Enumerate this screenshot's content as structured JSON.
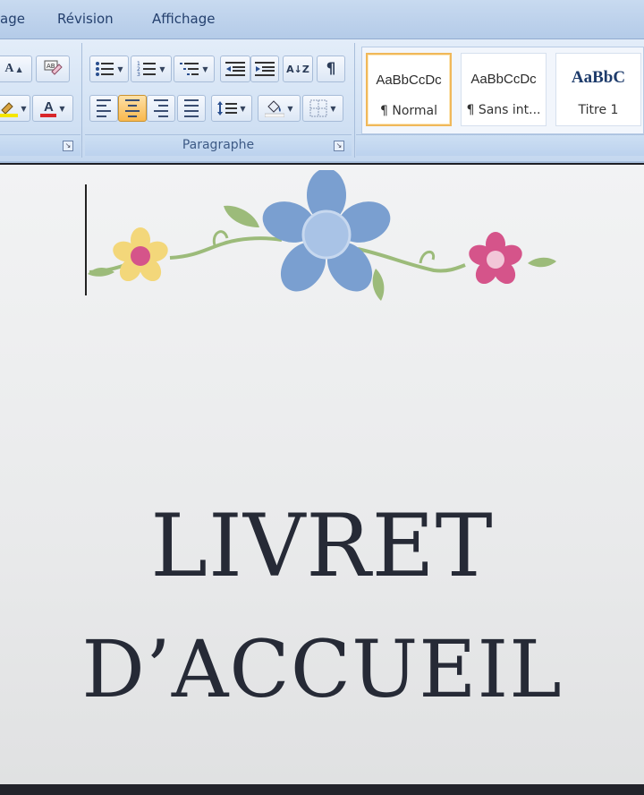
{
  "tabs": [
    {
      "label": "age"
    },
    {
      "label": "Révision"
    },
    {
      "label": "Affichage"
    }
  ],
  "ribbon": {
    "paragraph_group_label": "Paragraphe",
    "launcher_glyph": "↘",
    "font_buttons": {
      "grow_glyph": "A",
      "font_color_glyph": "A",
      "font_color_hex": "#d8262a",
      "highlight_hex": "#f5e600"
    },
    "paragraph_buttons": {
      "sort_glyph": "A↓Z",
      "pilcrow_glyph": "¶",
      "align_center_active": true
    },
    "styles": [
      {
        "sample": "AaBbCcDc",
        "name": "¶ Normal",
        "selected": true
      },
      {
        "sample": "AaBbCcDc",
        "name": "¶ Sans int...",
        "selected": false
      },
      {
        "sample": "AaBbC",
        "name": "Titre 1",
        "selected": false
      }
    ]
  },
  "document": {
    "title_line_1": "LIVRET",
    "title_line_2": "D’ACCUEIL",
    "decoration_icon": "floral-vine-icon",
    "flower_colors": {
      "yellow": "#f3d77a",
      "blue": "#7a9fd0",
      "pink": "#d5548a",
      "leaf": "#9cbb7a"
    }
  }
}
